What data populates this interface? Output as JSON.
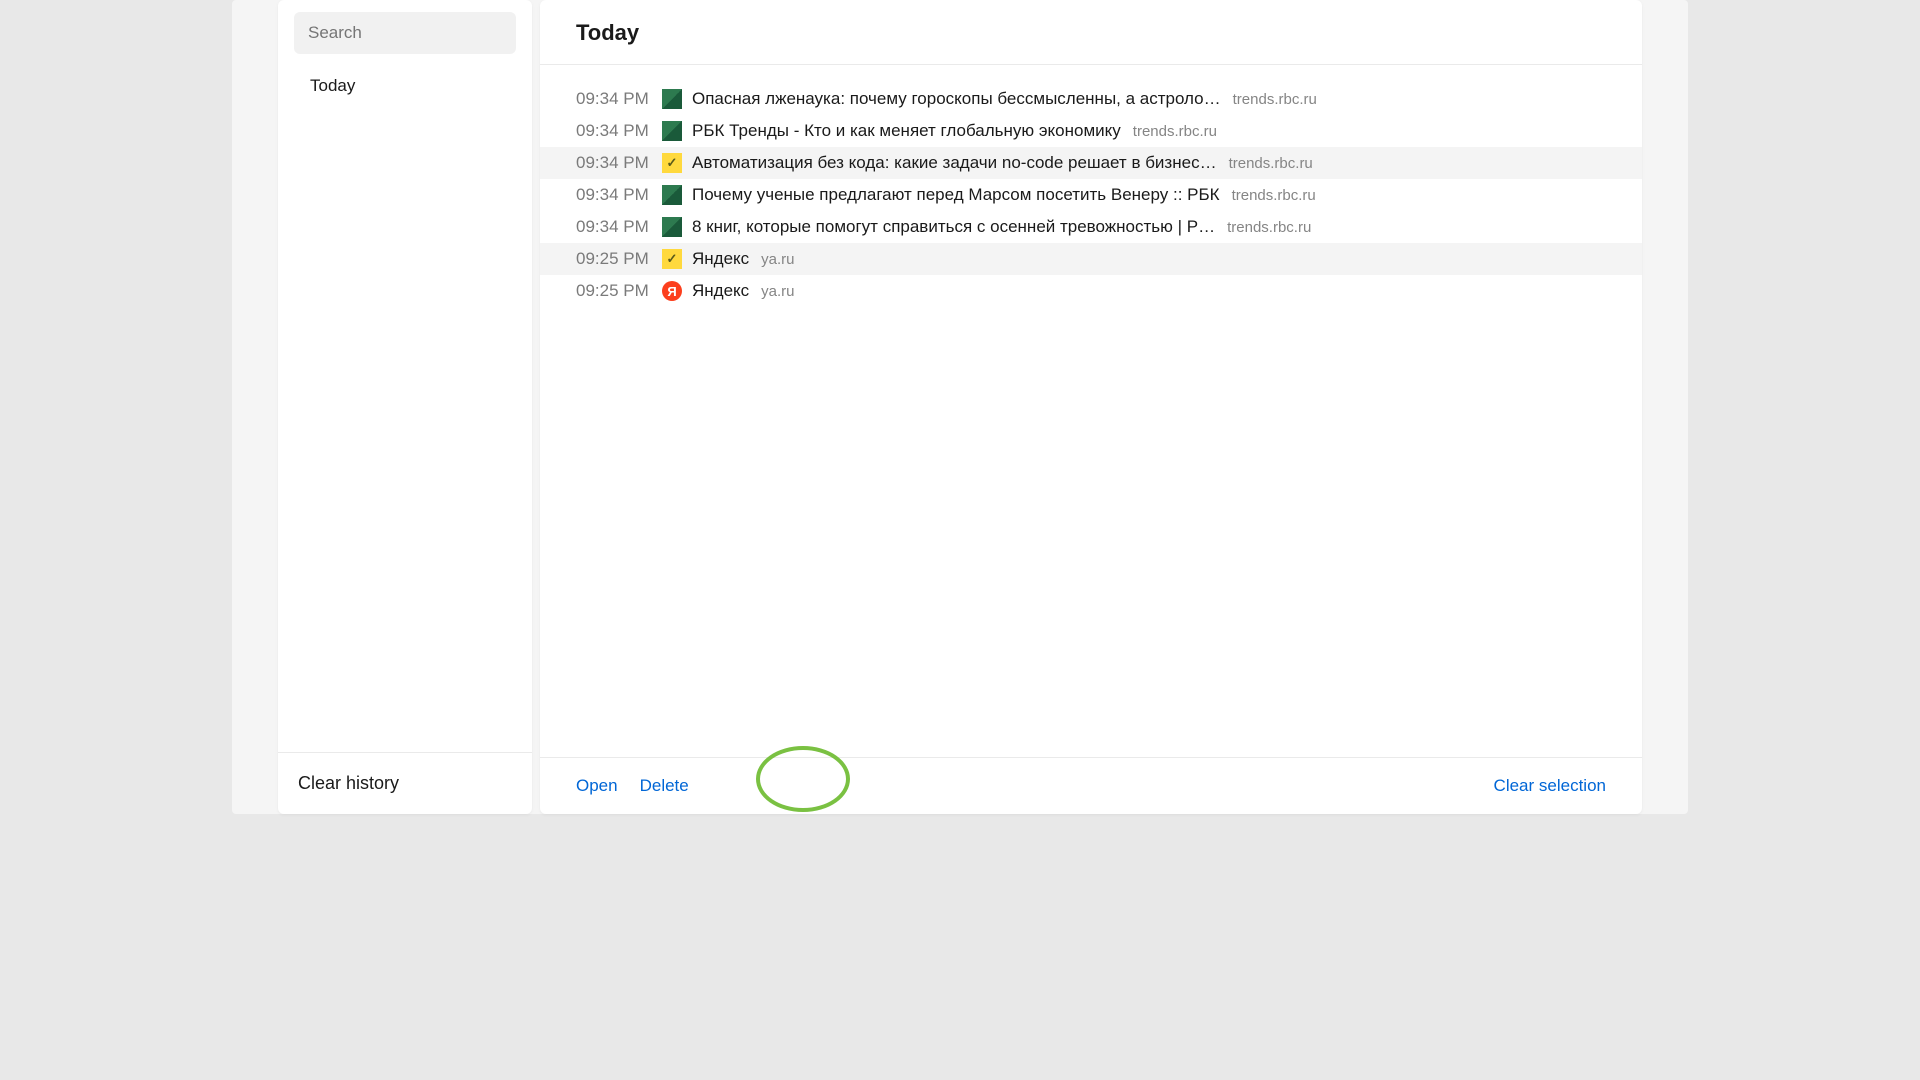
{
  "sidebar": {
    "search_placeholder": "Search",
    "nav": {
      "today": "Today"
    },
    "clear_history": "Clear history"
  },
  "main": {
    "title": "Today",
    "footer": {
      "open": "Open",
      "delete": "Delete",
      "clear_selection": "Clear selection"
    }
  },
  "history": [
    {
      "time": "09:34 PM",
      "icon": "rbc",
      "title": "Опасная лженаука: почему гороскопы бессмысленны, а астроло…",
      "domain": "trends.rbc.ru",
      "selected": false
    },
    {
      "time": "09:34 PM",
      "icon": "rbc",
      "title": "РБК Тренды - Кто и как меняет глобальную экономику",
      "domain": "trends.rbc.ru",
      "selected": false
    },
    {
      "time": "09:34 PM",
      "icon": "check",
      "title": "Автоматизация без кода: какие задачи no-code решает в бизнес…",
      "domain": "trends.rbc.ru",
      "selected": true
    },
    {
      "time": "09:34 PM",
      "icon": "rbc",
      "title": "Почему ученые предлагают перед Марсом посетить Венеру :: РБК",
      "domain": "trends.rbc.ru",
      "selected": false
    },
    {
      "time": "09:34 PM",
      "icon": "rbc",
      "title": "8 книг, которые помогут справиться с осенней тревожностью | Р…",
      "domain": "trends.rbc.ru",
      "selected": false
    },
    {
      "time": "09:25 PM",
      "icon": "check",
      "title": "Яндекс",
      "domain": "ya.ru",
      "selected": true
    },
    {
      "time": "09:25 PM",
      "icon": "yandex",
      "title": "Яндекс",
      "domain": "ya.ru",
      "selected": false
    }
  ]
}
